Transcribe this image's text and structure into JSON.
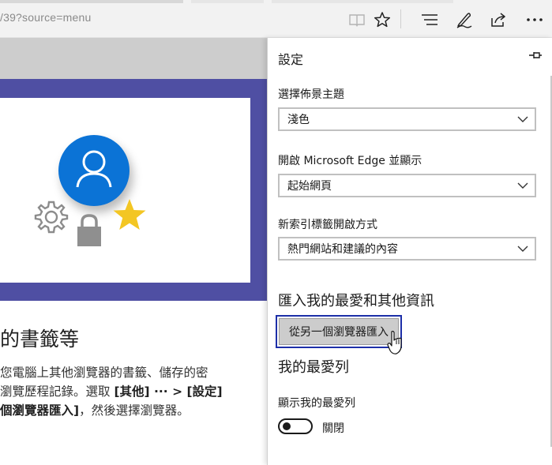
{
  "browser": {
    "address": "/39?source=menu",
    "icons": [
      "reading-view-icon",
      "favorite-star-icon",
      "hub-icon",
      "web-note-icon",
      "share-icon",
      "more-icon"
    ]
  },
  "page": {
    "heading": "的書籤等",
    "paragraph": {
      "line1": "您電腦上其他瀏覽器的書籤、儲存的密",
      "line2_prefix": "瀏覽歷程記錄。選取 ",
      "line2_bold": "[其他] ··· > [設定]",
      "line3_bold": "個瀏覽器匯入]",
      "line3_suffix": "，然後選擇瀏覽器。"
    },
    "colors": {
      "hero": "#4f4fa3",
      "avatar": "#0b73d6",
      "star": "#f3c623"
    }
  },
  "settings": {
    "title": "設定",
    "theme": {
      "label": "選擇佈景主題",
      "value": "淺色"
    },
    "open_with": {
      "label": "開啟 Microsoft Edge 並顯示",
      "value": "起始網頁"
    },
    "new_tab": {
      "label": "新索引標籤開啟方式",
      "value": "熱門網站和建議的內容"
    },
    "import_section": {
      "title": "匯入我的最愛和其他資訊",
      "button": "從另一個瀏覽器匯入"
    },
    "favorites_bar": {
      "title": "我的最愛列",
      "toggle_label": "顯示我的最愛列",
      "toggle_state": "關閉"
    }
  }
}
